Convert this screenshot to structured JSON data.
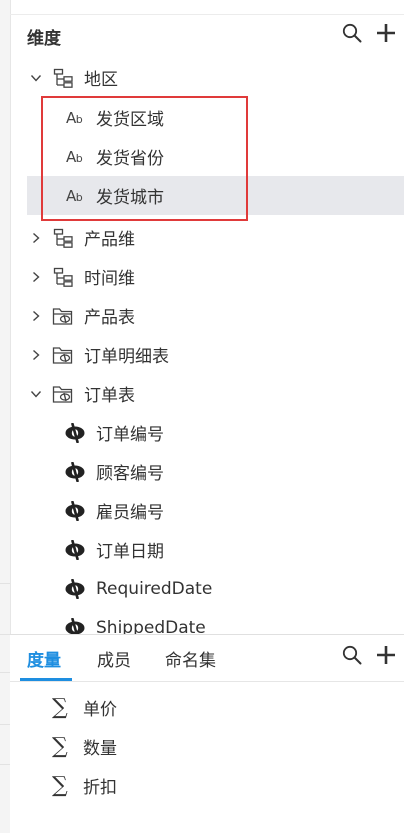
{
  "dimension_panel": {
    "title": "维度",
    "icons": {
      "search": "search-icon",
      "add": "plus-icon"
    },
    "tree": [
      {
        "label": "地区",
        "icon": "hierarchy-icon",
        "expanded": true
      },
      {
        "label": "发货区域",
        "icon": "text-field-icon",
        "type_glyph": "Ab",
        "child": true
      },
      {
        "label": "发货省份",
        "icon": "text-field-icon",
        "type_glyph": "Ab",
        "child": true
      },
      {
        "label": "发货城市",
        "icon": "text-field-icon",
        "type_glyph": "Ab",
        "child": true,
        "selected": true
      },
      {
        "label": "产品维",
        "icon": "hierarchy-icon",
        "expanded": false
      },
      {
        "label": "时间维",
        "icon": "hierarchy-icon",
        "expanded": false
      },
      {
        "label": "产品表",
        "icon": "table-folder-icon",
        "expanded": false
      },
      {
        "label": "订单明细表",
        "icon": "table-folder-icon",
        "expanded": false
      },
      {
        "label": "订单表",
        "icon": "table-folder-icon",
        "expanded": true
      },
      {
        "label": "订单编号",
        "icon": "eye-field-icon",
        "child": true
      },
      {
        "label": "顾客编号",
        "icon": "eye-field-icon",
        "child": true
      },
      {
        "label": "雇员编号",
        "icon": "eye-field-icon",
        "child": true
      },
      {
        "label": "订单日期",
        "icon": "eye-field-icon",
        "child": true
      },
      {
        "label": "RequiredDate",
        "icon": "eye-field-icon",
        "child": true
      },
      {
        "label": "ShippedDate",
        "icon": "eye-field-icon",
        "child": true
      }
    ]
  },
  "measure_panel": {
    "tabs": [
      {
        "label": "度量",
        "active": true
      },
      {
        "label": "成员",
        "active": false
      },
      {
        "label": "命名集",
        "active": false
      }
    ],
    "icons": {
      "search": "search-icon",
      "add": "plus-icon",
      "sum": "sigma-icon",
      "sum_glyph": "∑"
    },
    "items": [
      {
        "label": "单价"
      },
      {
        "label": "数量"
      },
      {
        "label": "折扣"
      }
    ]
  },
  "colors": {
    "accent": "#1e8ee0",
    "highlight_border": "#e03a3a",
    "selected_row": "#e7e8ec"
  }
}
